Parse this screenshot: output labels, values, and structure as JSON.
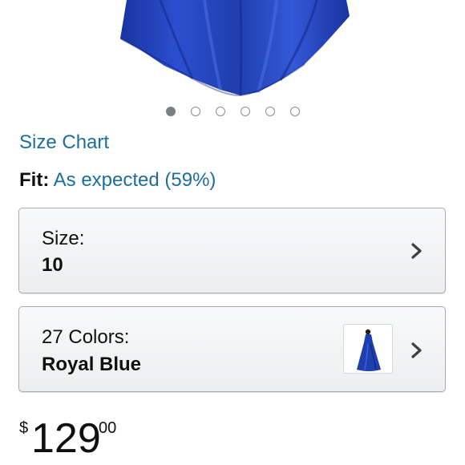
{
  "carousel": {
    "dot_count": 6,
    "active_index": 0
  },
  "size_chart": {
    "label": "Size Chart"
  },
  "fit": {
    "label": "Fit:",
    "value": "As expected (59%)"
  },
  "size_selector": {
    "label": "Size:",
    "value": "10",
    "icon": "chevron-right-icon"
  },
  "color_selector": {
    "label": "27 Colors:",
    "value": "Royal Blue",
    "icon": "chevron-right-icon",
    "swatch_color": "#1f3fae"
  },
  "price": {
    "symbol": "$",
    "whole": "129",
    "fraction": "00"
  },
  "colors": {
    "link": "#1b6e9c",
    "text": "#0f1111",
    "dress_blue": "#1f3fae"
  }
}
